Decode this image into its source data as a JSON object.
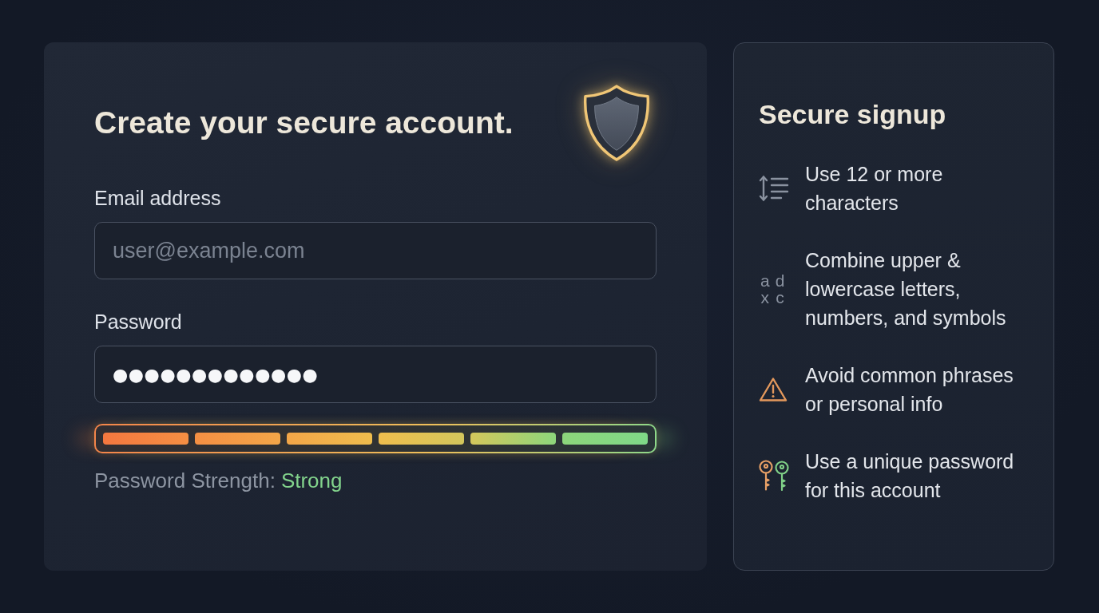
{
  "signup_form": {
    "title": "Create your secure account.",
    "email": {
      "label": "Email address",
      "placeholder": "user@example.com"
    },
    "password": {
      "label": "Password",
      "value": "●●●●●●●●●●●●●"
    },
    "strength": {
      "level": 1,
      "label": "Password Strength:",
      "value": "Strong"
    }
  },
  "tips_panel": {
    "title": "Secure signup",
    "tips": [
      {
        "kind": "length",
        "text": "Use 12 or more characters"
      },
      {
        "kind": "letters",
        "glyphs": [
          "a",
          "d",
          "x",
          "c"
        ],
        "text": "Combine upper & lowercase letters, numbers, and symbols"
      },
      {
        "kind": "warning",
        "text": "Avoid common phrases or personal info"
      },
      {
        "kind": "keys",
        "text": "Use a unique password for this account"
      }
    ]
  }
}
